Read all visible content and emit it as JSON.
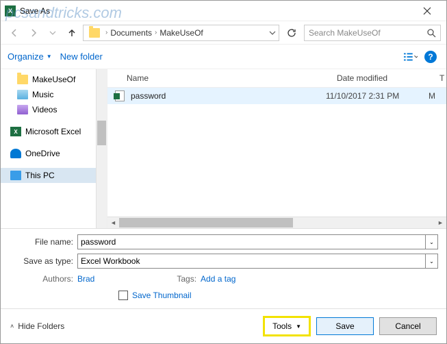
{
  "watermark": "pcsandtricks.com",
  "window": {
    "title": "Save As"
  },
  "breadcrumb": {
    "part1": "Documents",
    "part2": "MakeUseOf"
  },
  "search": {
    "placeholder": "Search MakeUseOf"
  },
  "toolbar": {
    "organize": "Organize",
    "new_folder": "New folder"
  },
  "tree": {
    "items": [
      {
        "label": "MakeUseOf",
        "icon": "folder"
      },
      {
        "label": "Music",
        "icon": "music"
      },
      {
        "label": "Videos",
        "icon": "videos"
      },
      {
        "label_spacer": ""
      },
      {
        "label": "Microsoft Excel",
        "icon": "excel"
      },
      {
        "label_spacer": ""
      },
      {
        "label": "OneDrive",
        "icon": "onedrive"
      },
      {
        "label_spacer": ""
      },
      {
        "label": "This PC",
        "icon": "pc"
      }
    ]
  },
  "columns": {
    "name": "Name",
    "date": "Date modified",
    "tail": "T"
  },
  "files": [
    {
      "name": "password",
      "date": "11/10/2017 2:31 PM",
      "tail": "M"
    }
  ],
  "form": {
    "file_name_label": "File name:",
    "file_name_value": "password",
    "save_type_label": "Save as type:",
    "save_type_value": "Excel Workbook",
    "authors_label": "Authors:",
    "authors_value": "Brad",
    "tags_label": "Tags:",
    "tags_value": "Add a tag",
    "thumb_label": "Save Thumbnail"
  },
  "footer": {
    "hide_folders": "Hide Folders",
    "tools": "Tools",
    "save": "Save",
    "cancel": "Cancel"
  }
}
